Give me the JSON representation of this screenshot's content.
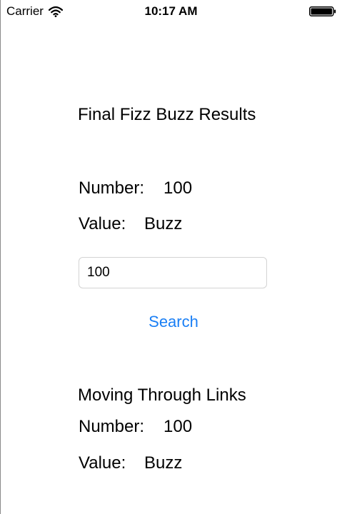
{
  "status_bar": {
    "carrier": "Carrier",
    "time": "10:17 AM",
    "wifi_icon": "wifi-icon",
    "battery_icon": "battery-icon"
  },
  "final_results": {
    "title": "Final Fizz Buzz Results",
    "number_label": "Number:",
    "number_value": "100",
    "value_label": "Value:",
    "value_value": "Buzz"
  },
  "search": {
    "input_value": "100",
    "button_label": "Search"
  },
  "links_section": {
    "title": "Moving Through Links",
    "number_label": "Number:",
    "number_value": "100",
    "value_label": "Value:",
    "value_value": "Buzz"
  },
  "colors": {
    "accent": "#1a7ff5",
    "text": "#000000",
    "field_border": "#d3d3d3"
  }
}
